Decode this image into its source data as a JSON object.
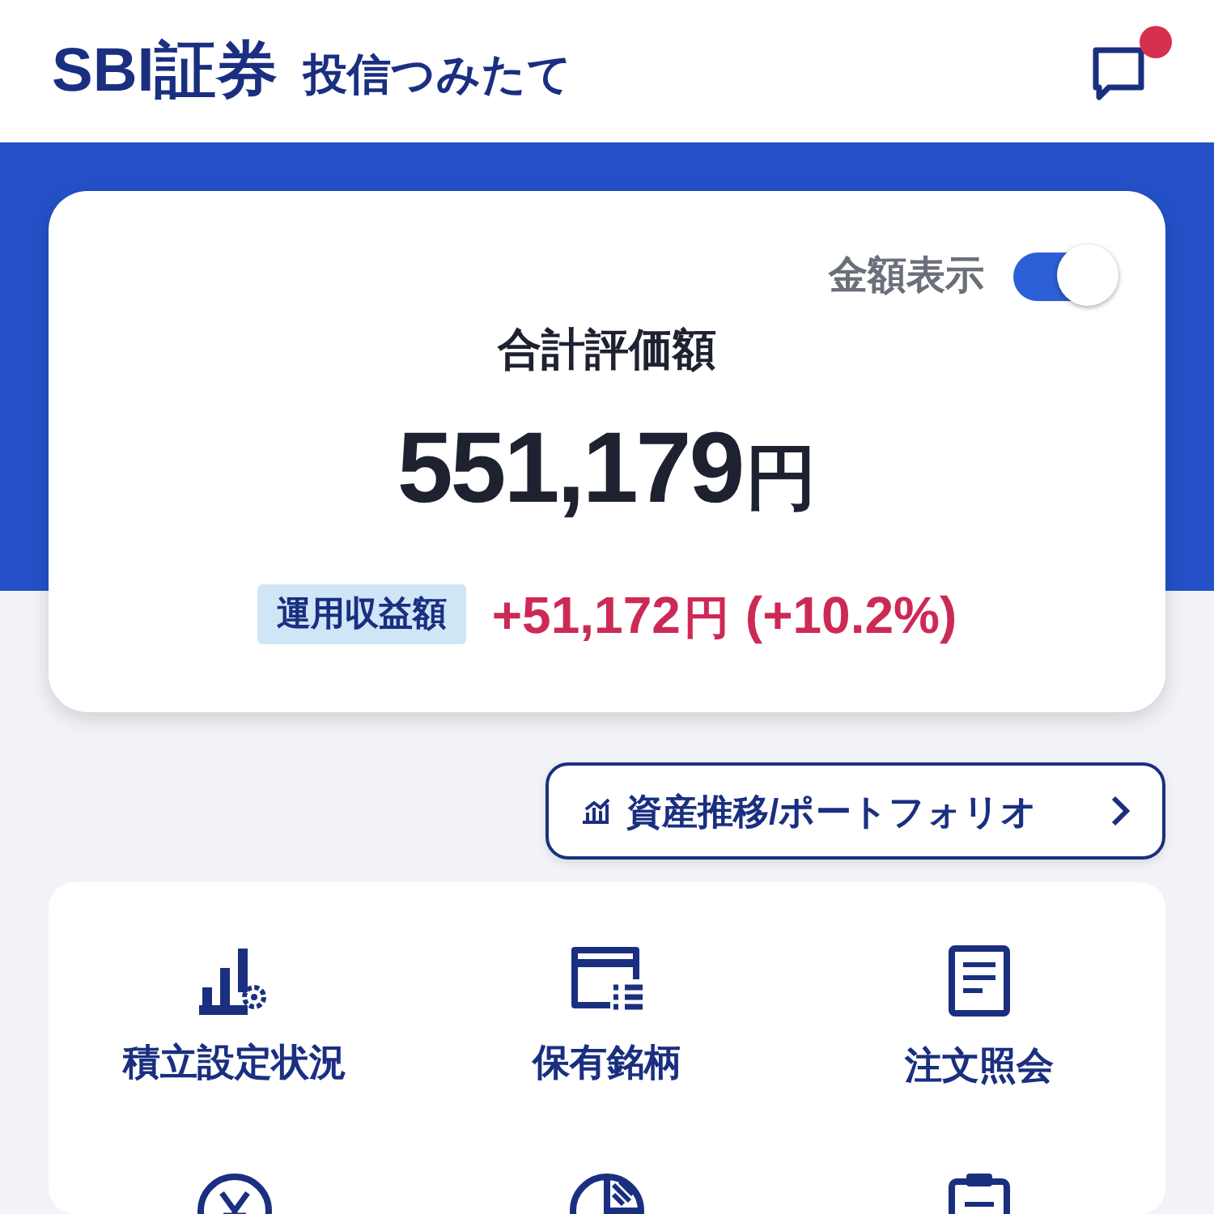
{
  "header": {
    "logo": "SBI証券",
    "app_name": "投信つみたて",
    "unread": true
  },
  "summary": {
    "toggle": {
      "label": "金額表示",
      "on": true
    },
    "title": "合計評価額",
    "total": "551,179",
    "unit": "円",
    "profit_label": "運用収益額",
    "profit": "+51,172",
    "profit_unit": "円",
    "profit_rate": "(+10.2%)"
  },
  "portfolio_button": {
    "label": "資産推移/ポートフォリオ"
  },
  "menu": [
    {
      "kind": "plan",
      "label": "積立設定状況"
    },
    {
      "kind": "holdings",
      "label": "保有銘柄"
    },
    {
      "kind": "orders",
      "label": "注文照会"
    },
    {
      "kind": "yen"
    },
    {
      "kind": "pie"
    },
    {
      "kind": "clipboard"
    }
  ]
}
